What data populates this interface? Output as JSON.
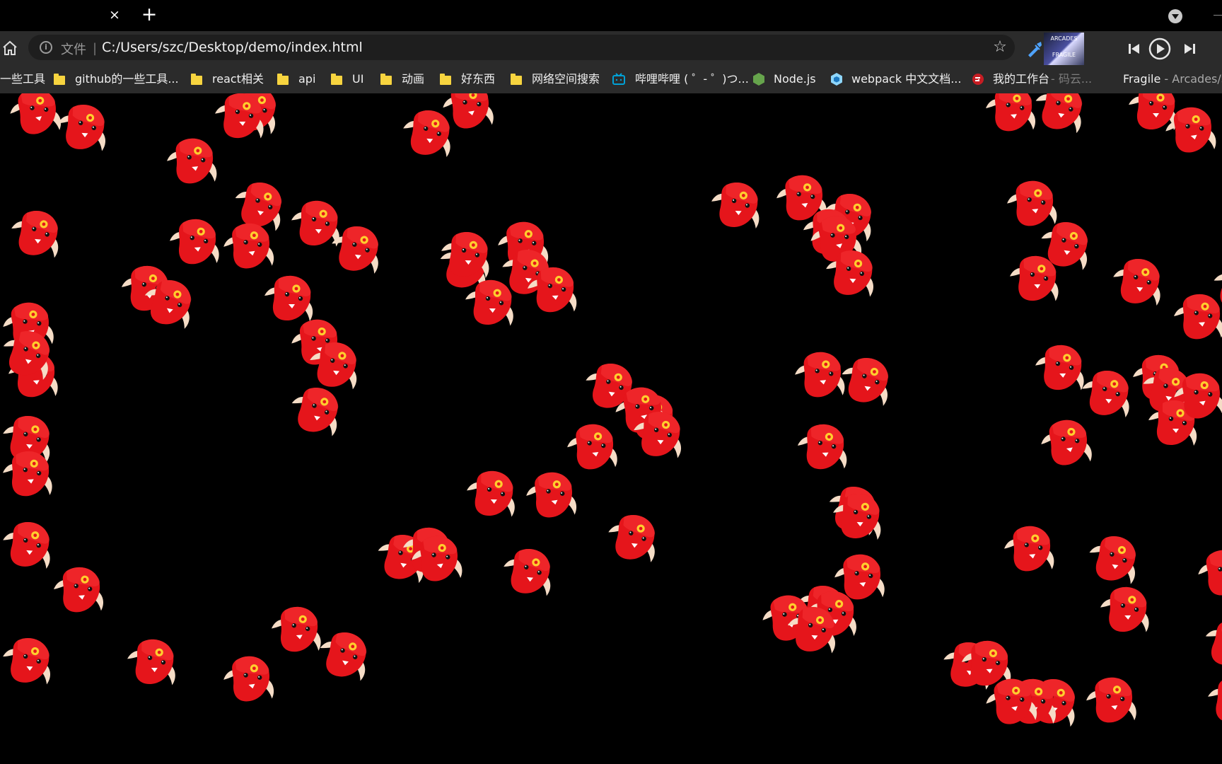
{
  "browser": {
    "tab": {
      "close_symbol": "×",
      "new_tab_symbol": "+"
    },
    "toolbar": {
      "file_label": "文件",
      "separator": "|",
      "url": "C:/Users/szc/Desktop/demo/index.html",
      "star_symbol": "☆"
    },
    "media": {
      "album_text_top": "ARCADES",
      "album_text_bottom": "FRAGILE",
      "now_playing_title": "Fragile",
      "now_playing_separator": "-",
      "now_playing_artist": "Arcades/S",
      "ghost_text": "- 码云..."
    },
    "bookmarks": [
      {
        "label": "一些工具",
        "icon": "folder-icon"
      },
      {
        "label": "github的一些工具...",
        "icon": "folder-icon"
      },
      {
        "label": "react相关",
        "icon": "folder-icon"
      },
      {
        "label": "api",
        "icon": "folder-icon"
      },
      {
        "label": "UI",
        "icon": "folder-icon"
      },
      {
        "label": "动画",
        "icon": "folder-icon"
      },
      {
        "label": "好东西",
        "icon": "folder-icon"
      },
      {
        "label": "网络空间搜索",
        "icon": "folder-icon"
      },
      {
        "label": "哔哩哔哩 ( ゜- ゜)つ...",
        "icon": "bilibili-icon"
      },
      {
        "label": "Node.js",
        "icon": "nodejs-icon"
      },
      {
        "label": "webpack 中文文档...",
        "icon": "webpack-icon"
      },
      {
        "label": "我的工作台",
        "icon": "gitee-icon"
      }
    ]
  },
  "canvas": {
    "item_name": "red-bird",
    "colors": {
      "body": "#e5151b",
      "wing": "#f5dcc6",
      "eye": "#ffce2e",
      "pupil": "#111111"
    }
  }
}
